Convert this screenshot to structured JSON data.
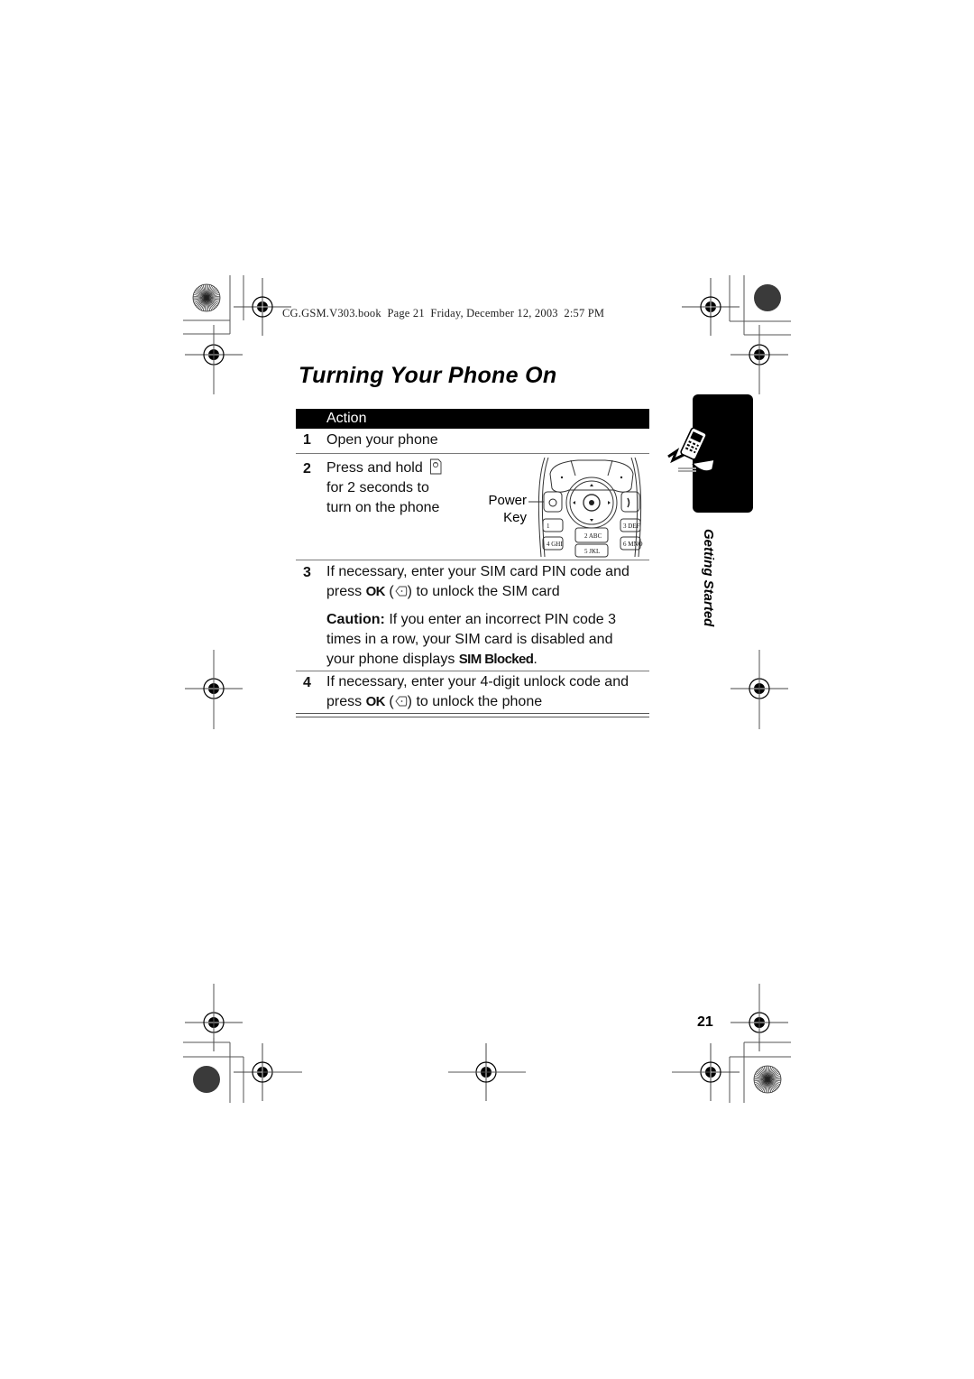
{
  "print_header": "CG.GSM.V303.book  Page 21  Friday, December 12, 2003  2:57 PM",
  "page_title": "Turning Your Phone On",
  "table": {
    "header": "Action",
    "rows": [
      {
        "number": "1",
        "lines": [
          "Open your phone"
        ]
      },
      {
        "number": "2",
        "lines": [
          "Press and hold",
          "for 2 seconds to",
          "turn on the phone"
        ],
        "icon": "power-key-icon"
      },
      {
        "number": "3",
        "line1": "If necessary, enter your SIM card PIN code and",
        "line2_pre": "press ",
        "line2_key": "OK",
        "line2_post": " to unlock the SIM card",
        "caution_label": "Caution:",
        "caution_l1": " If you enter an incorrect PIN code 3",
        "caution_l2": "times in a row, your SIM card is disabled and",
        "caution_l3_pre": "your phone displays ",
        "caution_l3_key": "SIM Blocked",
        "caution_l3_post": "."
      },
      {
        "number": "4",
        "line1": "If necessary, enter your 4-digit unlock code and",
        "line2_pre": "press ",
        "line2_key": "OK",
        "line2_post": " to unlock the phone"
      }
    ]
  },
  "illustration": {
    "callout_line1": "Power",
    "callout_line2": "Key",
    "keys": [
      "1",
      "2 ABC",
      "3 DEF",
      "4 GHI",
      "5 JKL",
      "6 MNO"
    ]
  },
  "section_tab": {
    "label": "Getting Started",
    "icon": "running-phone-icon"
  },
  "page_number": "21"
}
